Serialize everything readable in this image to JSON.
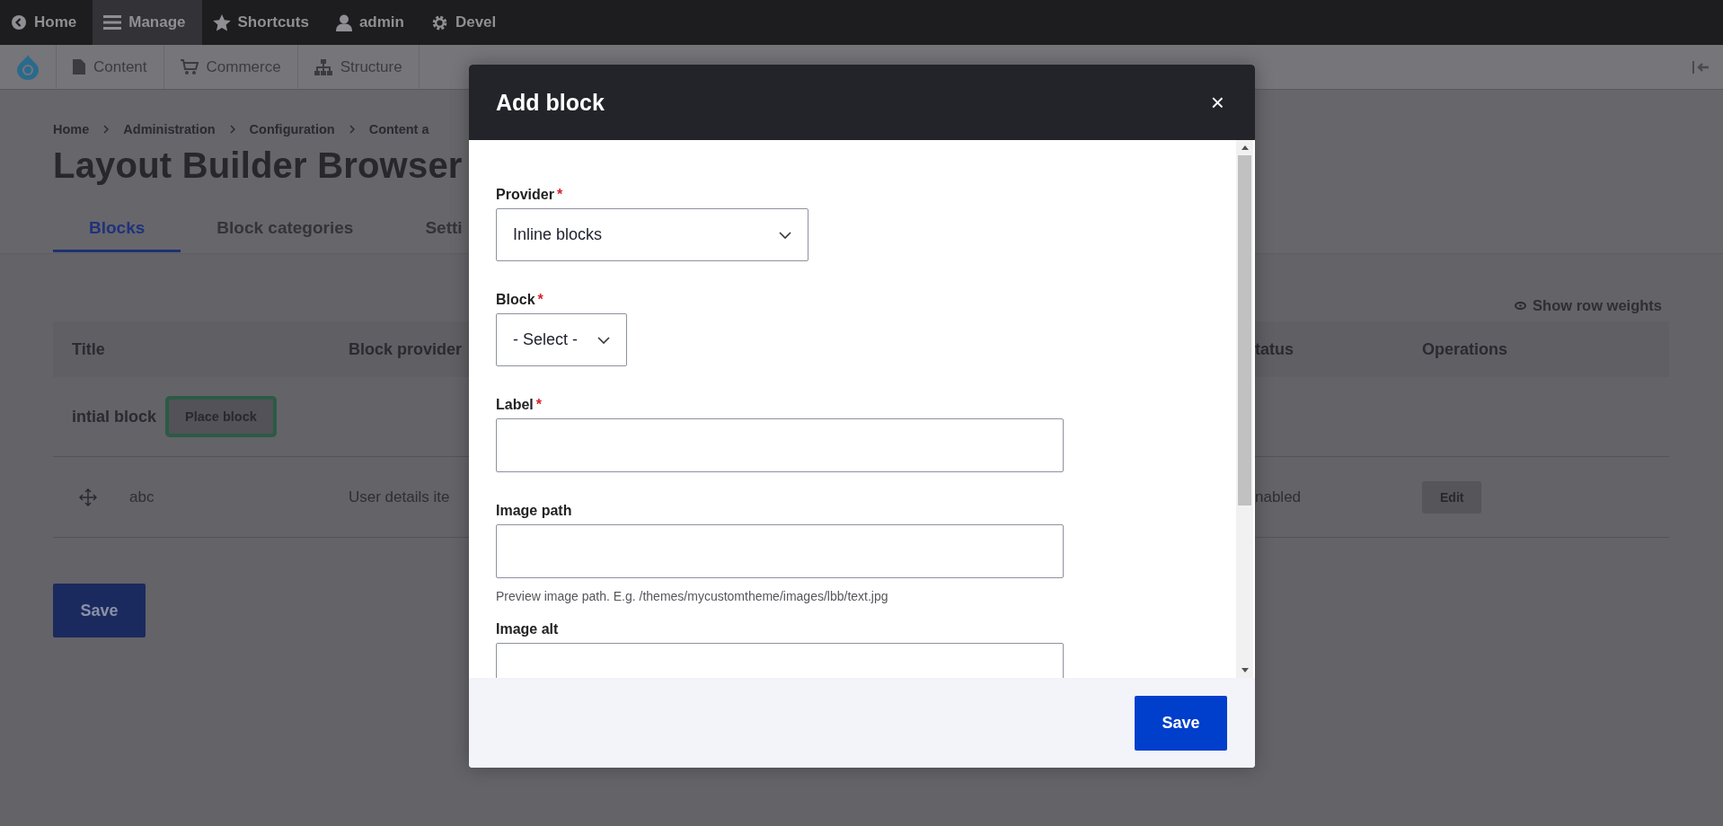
{
  "toolbar": {
    "items": [
      {
        "label": "Home",
        "selected": false
      },
      {
        "label": "Manage",
        "selected": true
      },
      {
        "label": "Shortcuts",
        "selected": false
      },
      {
        "label": "admin",
        "selected": false
      },
      {
        "label": "Devel",
        "selected": false
      }
    ]
  },
  "admin_menu": {
    "items": [
      {
        "label": "Content"
      },
      {
        "label": "Commerce"
      },
      {
        "label": "Structure"
      }
    ]
  },
  "breadcrumb": [
    "Home",
    "Administration",
    "Configuration",
    "Content a"
  ],
  "page_title": "Layout Builder Browser",
  "tabs": [
    {
      "label": "Blocks",
      "selected": true
    },
    {
      "label": "Block categories",
      "selected": false
    },
    {
      "label": "Setti",
      "selected": false
    }
  ],
  "row_weights_link": "Show row weights",
  "table": {
    "columns": [
      "Title",
      "Block provider",
      "tatus",
      "Operations"
    ],
    "category_rows": [
      {
        "title": "intial block",
        "button": "Place block"
      }
    ],
    "rows": [
      {
        "title": "abc",
        "provider": "User details ite",
        "status": "nabled",
        "button": "Edit"
      }
    ]
  },
  "save_button": "Save",
  "dialog": {
    "title": "Add block",
    "close": "×",
    "fields": [
      {
        "kind": "select",
        "label": "Provider",
        "required_mark": "*",
        "value": "Inline blocks"
      },
      {
        "kind": "select",
        "label": "Block",
        "required_mark": "*",
        "value": "- Select -"
      },
      {
        "kind": "text",
        "label": "Label",
        "required_mark": "*"
      },
      {
        "kind": "text",
        "label": "Image path",
        "description": "Preview image path. E.g. /themes/mycustomtheme/images/lbb/text.jpg"
      },
      {
        "kind": "text",
        "label": "Image alt"
      }
    ],
    "save_button": "Save"
  }
}
